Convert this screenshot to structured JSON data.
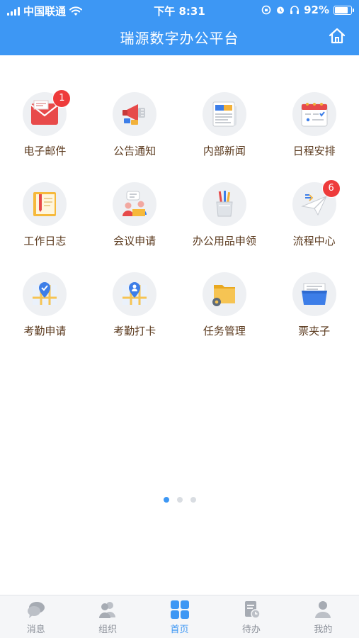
{
  "status_bar": {
    "carrier": "中国联通",
    "time": "下午 8:31",
    "battery": "92%",
    "battery_level": 0.92
  },
  "header": {
    "title": "瑞源数字办公平台"
  },
  "apps": [
    {
      "label": "电子邮件",
      "icon": "email-icon",
      "badge": "1"
    },
    {
      "label": "公告通知",
      "icon": "megaphone-icon",
      "badge": ""
    },
    {
      "label": "内部新闻",
      "icon": "newspaper-icon",
      "badge": ""
    },
    {
      "label": "日程安排",
      "icon": "calendar-icon",
      "badge": ""
    },
    {
      "label": "工作日志",
      "icon": "notebook-icon",
      "badge": ""
    },
    {
      "label": "会议申请",
      "icon": "meeting-icon",
      "badge": ""
    },
    {
      "label": "办公用品申领",
      "icon": "pen-holder-icon",
      "badge": ""
    },
    {
      "label": "流程中心",
      "icon": "paper-plane-icon",
      "badge": "6"
    },
    {
      "label": "考勤申请",
      "icon": "map-check-icon",
      "badge": ""
    },
    {
      "label": "考勤打卡",
      "icon": "map-person-icon",
      "badge": ""
    },
    {
      "label": "任务管理",
      "icon": "folder-gear-icon",
      "badge": ""
    },
    {
      "label": "票夹子",
      "icon": "ticket-folder-icon",
      "badge": ""
    }
  ],
  "pagination": {
    "pages": 3,
    "current": 1
  },
  "tabbar": [
    {
      "label": "消息",
      "icon": "chat-bubble-icon",
      "active": false
    },
    {
      "label": "组织",
      "icon": "people-icon",
      "active": false
    },
    {
      "label": "首页",
      "icon": "grid-icon",
      "active": true
    },
    {
      "label": "待办",
      "icon": "todo-icon",
      "active": false
    },
    {
      "label": "我的",
      "icon": "user-icon",
      "active": false
    }
  ],
  "colors": {
    "primary": "#3d97f4",
    "badge": "#ee3b3b",
    "label": "#5b3a1e",
    "tab_inactive": "#8a8f98"
  }
}
